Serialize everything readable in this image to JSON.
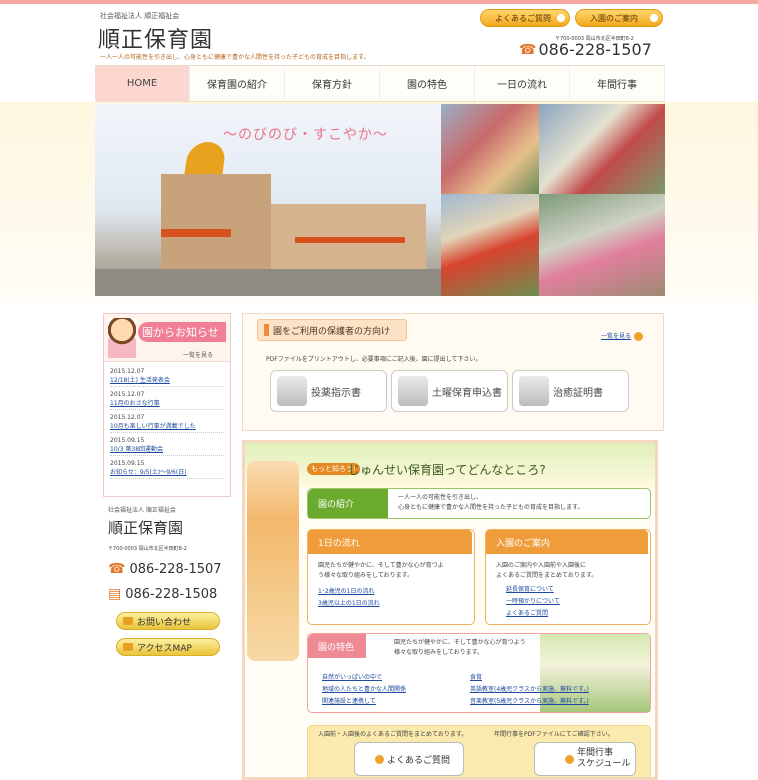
{
  "header": {
    "corp": "社会福祉法人 順正福祉会",
    "title": "順正保育園",
    "tagline": "一人一人の可能性を引き出し、心身ともに健康で豊かな人間性を持った子どもの育成を目指します。",
    "faq_label": "よくあるご質問",
    "admission_label": "入園のご案内",
    "address": "〒700-0003 岡山市北区半田町8-2",
    "tel": "086-228-1507"
  },
  "nav": {
    "items": [
      "HOME",
      "保育園の紹介",
      "保育方針",
      "園の特色",
      "一日の流れ",
      "年間行事"
    ]
  },
  "hero": {
    "catch": "〜のびのび・すこやか〜"
  },
  "news": {
    "title": "園からお知らせ",
    "view_all": "一覧を見る",
    "items": [
      {
        "date": "2015.12.07",
        "title": "12/18(土) 生活発表会"
      },
      {
        "date": "2015.12.07",
        "title": "11月のおさな行事"
      },
      {
        "date": "2015.12.07",
        "title": "10月も楽しい行事が満載でした"
      },
      {
        "date": "2015.09.15",
        "title": "10/3 第38回運動会"
      },
      {
        "date": "2015.09.15",
        "title": "お知らせ：9/5(土)〜9/6(日)"
      }
    ]
  },
  "sidebar": {
    "corp": "社会福祉法人 順正福祉会",
    "name": "順正保育園",
    "address": "〒700-0003 岡山市北区半田町8-2",
    "tel": "086-228-1507",
    "fax": "086-228-1508",
    "contact_label": "お問い合わせ",
    "access_label": "アクセスMAP"
  },
  "guardian": {
    "title": "園をご利用の保護者の方向け",
    "more": "一覧を見る",
    "note": "PDFファイルをプリントアウトし、必要事項にご記入後、園に提出して下さい。",
    "buttons": [
      "投薬指示書",
      "土曜保育申込書",
      "治癒証明書"
    ]
  },
  "about": {
    "badge": "もっと知ろう!",
    "title": "じゅんせい保育園ってどんなところ?",
    "intro_head": "園の紹介",
    "intro_text_1": "一人一人の可能性を引き出し、",
    "intro_text_2": "心身ともに健康で豊かな人間性を持った子どもの育成を目指します。",
    "flow_head": "1日の流れ",
    "flow_text_1": "園児たちが健やかに、そして豊かな心が育つよ",
    "flow_text_2": "う様々な取り組みをしております。",
    "flow_links": [
      "1･2歳児の1日の流れ",
      "3歳児以上の1日の流れ"
    ],
    "admission_head": "入園のご案内",
    "admission_text_1": "入園のご案内や入園前や入園後に",
    "admission_text_2": "よくあるご質問をまとめております。",
    "admission_links": [
      "延長保育について",
      "一時預かりについて",
      "よくあるご質問"
    ],
    "feature_head": "園の特色",
    "feature_text_1": "園児たちが健やかに、そして豊かな心が育つよう",
    "feature_text_2": "様々な取り組みをしております。",
    "feature_links_left": [
      "自然がいっぱいの中で",
      "地域の人たちと豊かな人間関係",
      "関連施設と連携して"
    ],
    "feature_links_right": [
      "食育",
      "英語教室(4歳児クラスから実施、無料です。)",
      "音楽教室(5歳児クラスから実施、無料です。)"
    ],
    "bottom_text_1": "入園前・入園後のよくあるご質問をまとめております。",
    "bottom_text_2": "年間行事をPDFファイルにてご確認下さい。",
    "bottom_btn_1": "よくあるご質問",
    "bottom_btn_2_line1": "年間行事",
    "bottom_btn_2_line2": "スケジュール"
  }
}
